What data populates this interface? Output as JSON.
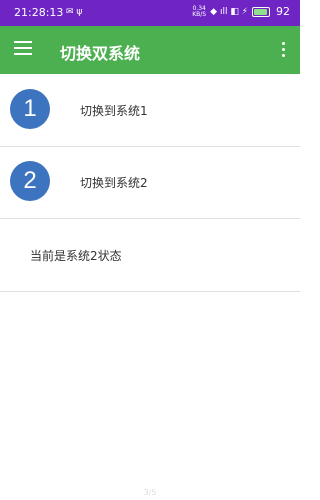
{
  "status_bar": {
    "time": "21:28:13",
    "left_icons": "✉ ψ",
    "net_speed_top": "0.34",
    "net_speed_bottom": "KB/S",
    "signal_icons": "◆ ıll ◧ ⚡",
    "battery_level": 92,
    "battery_text": "92",
    "background_color": "#6f25c4"
  },
  "toolbar": {
    "title": "切换双系统",
    "menu_icon": "hamburger-menu-icon",
    "overflow_icon": "more-vert-icon",
    "background_color": "#4caf50"
  },
  "items": [
    {
      "number": "1",
      "label": "切换到系统1"
    },
    {
      "number": "2",
      "label": "切换到系统2"
    }
  ],
  "status_message": "当前是系统2状态",
  "page_indicator": "3/5",
  "accent_color": "#3d74bf"
}
